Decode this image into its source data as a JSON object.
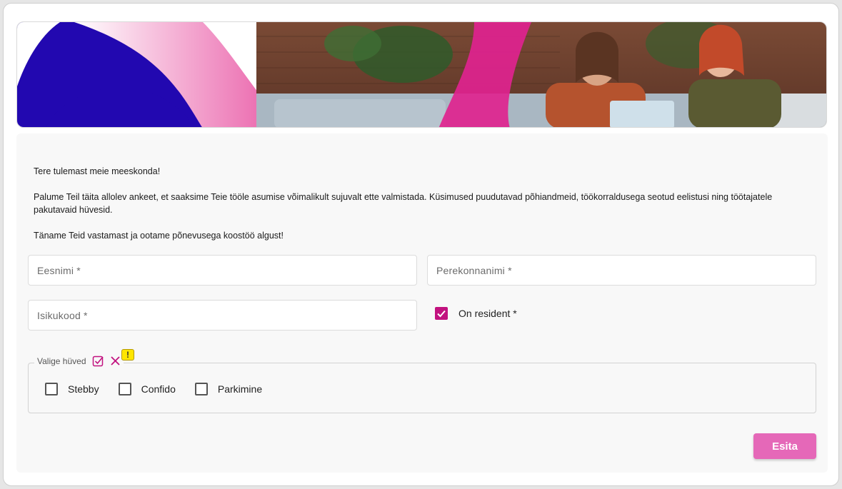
{
  "intro": {
    "greeting": "Tere tulemast meie meeskonda!",
    "instructions": "Palume Teil täita allolev ankeet, et saaksime Teie tööle asumise võimalikult sujuvalt ette valmistada. Küsimused puudutavad põhiandmeid, töökorraldusega seotud eelistusi ning töötajatele pakutavaid hüvesid.",
    "closing": "Täname Teid vastamast ja ootame põnevusega koostöö algust!"
  },
  "form": {
    "first_name": {
      "placeholder": "Eesnimi *",
      "value": ""
    },
    "last_name": {
      "placeholder": "Perekonnanimi *",
      "value": ""
    },
    "id_code": {
      "placeholder": "Isikukood *",
      "value": ""
    },
    "resident": {
      "label": "On resident *",
      "checked": true
    },
    "benefits": {
      "legend": "Valige hüved",
      "warning_badge": "!",
      "options": [
        {
          "label": "Stebby",
          "checked": false
        },
        {
          "label": "Confido",
          "checked": false
        },
        {
          "label": "Parkimine",
          "checked": false
        }
      ]
    },
    "submit_label": "Esita"
  },
  "colors": {
    "accent": "#c2127f",
    "button": "#e568b8",
    "banner_blue": "#2208b0",
    "banner_pink": "#e0238f",
    "warning": "#ffe600"
  },
  "icons": {
    "select_all": "check-square-icon",
    "clear_all": "close-icon"
  }
}
